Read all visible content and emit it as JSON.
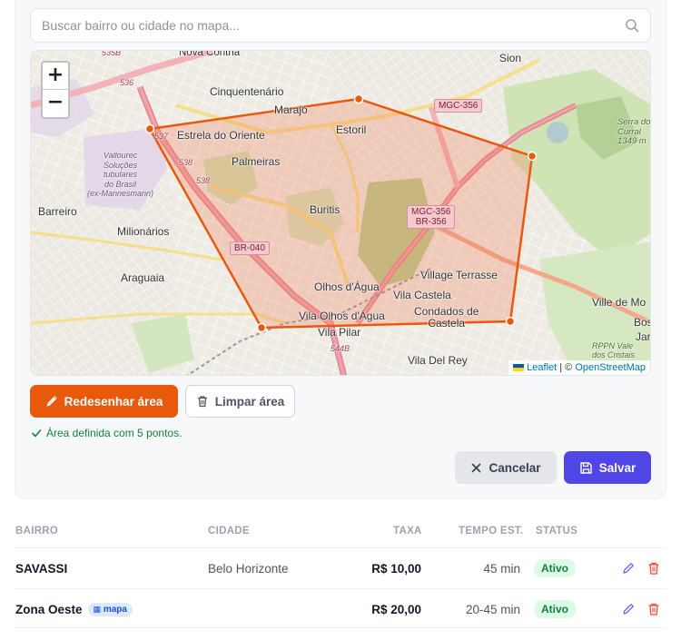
{
  "search": {
    "placeholder": "Buscar bairro ou cidade no mapa..."
  },
  "map": {
    "zoom_in": "+",
    "zoom_out": "−",
    "attribution_leaflet": "Leaflet",
    "attribution_sep": " | © ",
    "attribution_osm": "OpenStreetMap",
    "labels": {
      "nova_contria": "Nova Contria",
      "cinquentenario": "Cinquentenário",
      "marajo": "Marajó",
      "sion": "Sion",
      "estrela": "Estrela do Oriente",
      "estoril": "Estoril",
      "palmeiras": "Palmeiras",
      "vallourec": "Vallourec\nSoluções\ntubulares\ndo Brasil\n(ex-Mannesmann)",
      "barreiro": "Barreiro",
      "buritis": "Buritis",
      "milionarios": "Milionários",
      "araguaia": "Araguaia",
      "village": "Village Terrasse",
      "olhos": "Olhos d'Água",
      "vila_castela": "Vila Castela",
      "vila_olhos": "Vila Olhos d'Água",
      "condados": "Condados de\nCastela",
      "vila_pilar": "Vila Pilar",
      "vila_del_rey": "Vila Del Rey",
      "ville": "Ville de Mo",
      "serra": "Serra do\nCurral\n1349 m",
      "rppn": "RPPN Vale\ndos Cristais",
      "bos": "Bos",
      "jar": "Jar"
    },
    "shields": {
      "mgc356_top": "MGC-356",
      "mgc356_br": "MGC-356\nBR-356",
      "br040": "BR-040",
      "r535": "535B",
      "r536": "536",
      "r537": "537",
      "r538a": "538",
      "r538b": "538",
      "r544": "544B"
    }
  },
  "actions": {
    "redraw": "Redesenhar área",
    "clear": "Limpar área",
    "cancel": "Cancelar",
    "save": "Salvar"
  },
  "area_status": "Área definida com 5 pontos.",
  "colors": {
    "accent": "#e8590c",
    "primary": "#4f46e5",
    "success": "#15803d"
  },
  "table": {
    "headers": {
      "bairro": "BAIRRO",
      "cidade": "CIDADE",
      "taxa": "TAXA",
      "tempo": "TEMPO EST.",
      "status": "STATUS"
    },
    "rows": [
      {
        "bairro": "SAVASSI",
        "cidade": "Belo Horizonte",
        "taxa": "R$ 10,00",
        "tempo": "45 min",
        "status": "Ativo",
        "chip": ""
      },
      {
        "bairro": "Zona Oeste",
        "cidade": "",
        "taxa": "R$ 20,00",
        "tempo": "20-45 min",
        "status": "Ativo",
        "chip": "mapa"
      }
    ]
  }
}
